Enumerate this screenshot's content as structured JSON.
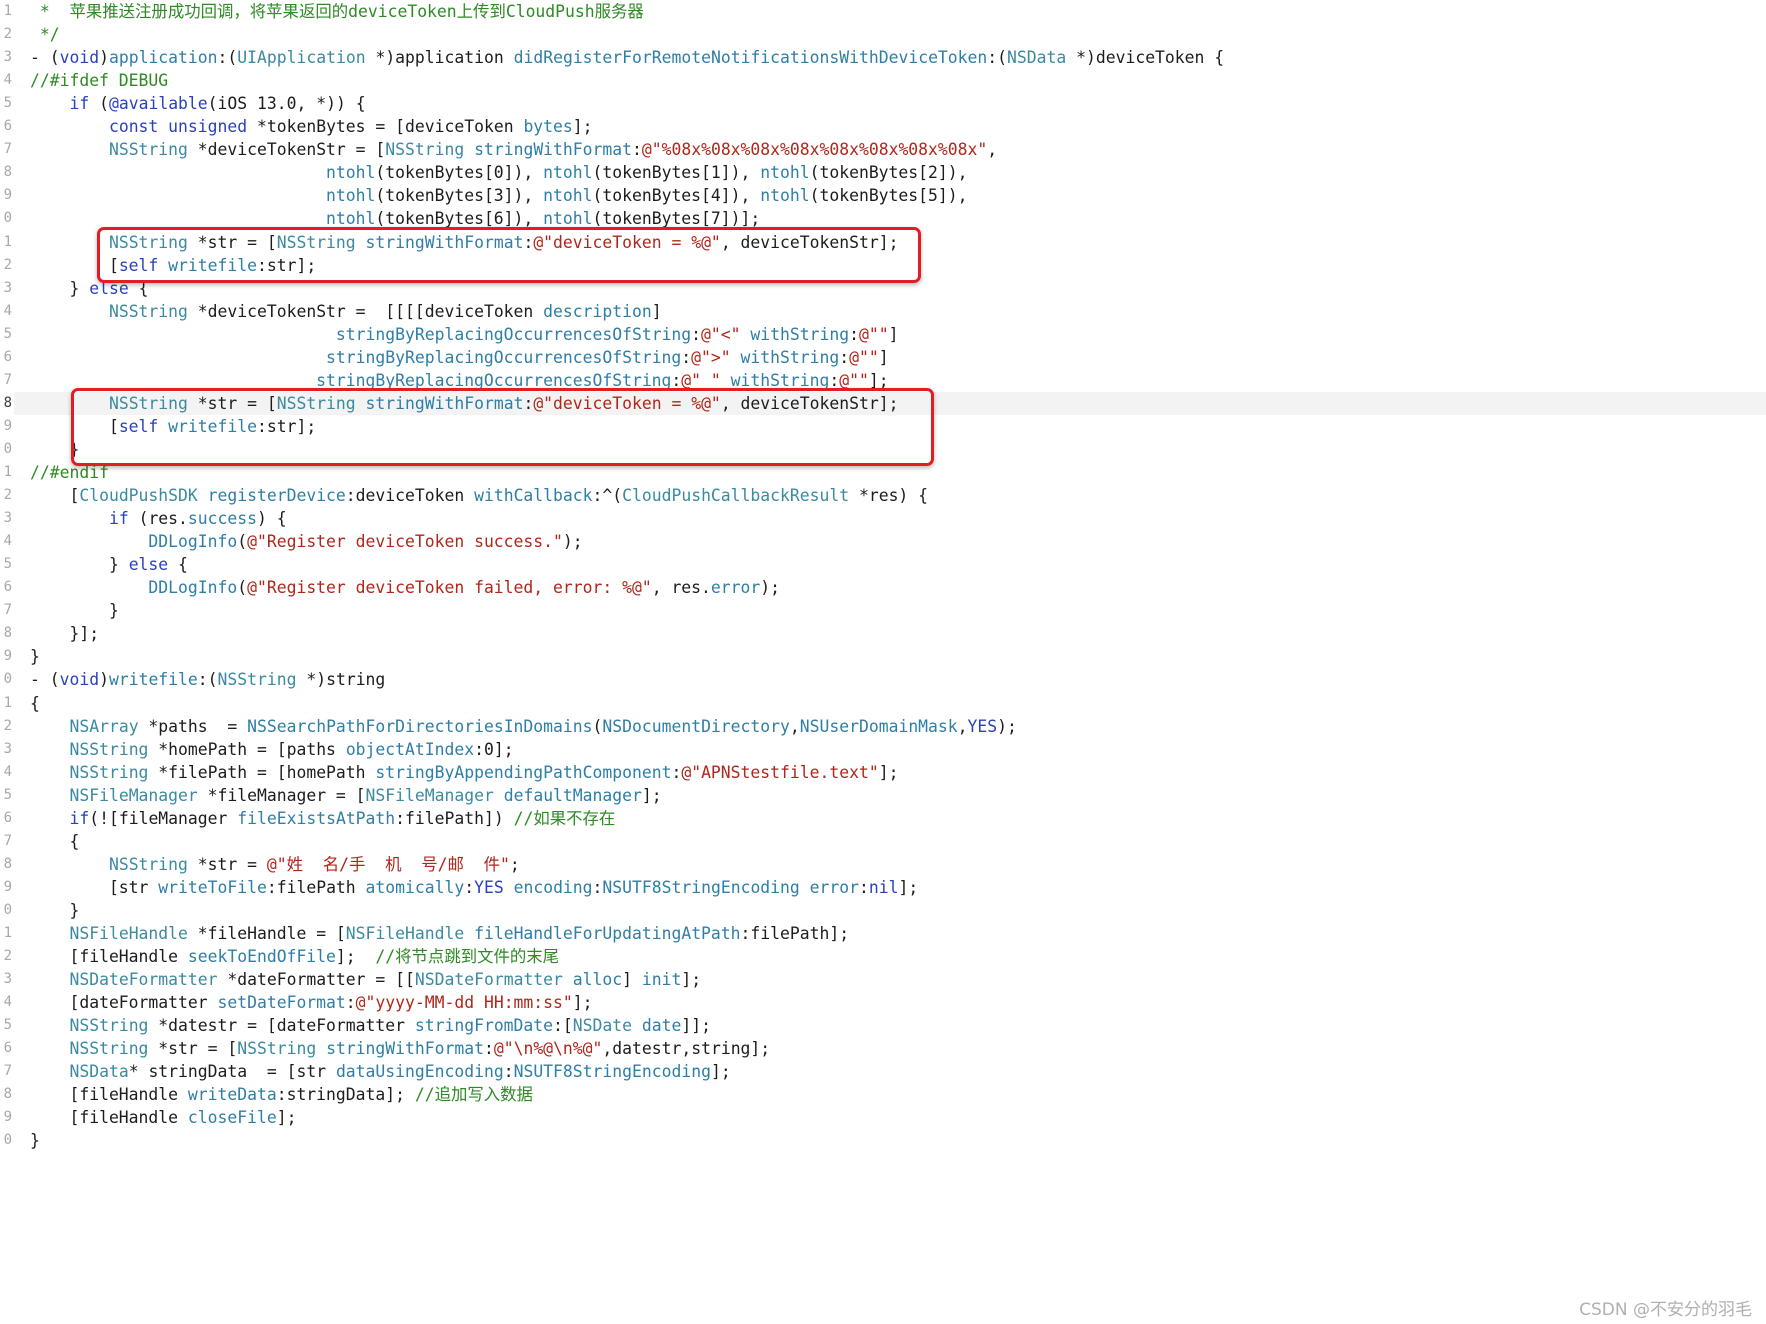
{
  "editor": {
    "line_numbers": [
      "1",
      "2",
      "3",
      "4",
      "5",
      "6",
      "7",
      "8",
      "9",
      "0",
      "1",
      "2",
      "3",
      "4",
      "5",
      "6",
      "7",
      "8",
      "9",
      "0",
      "1",
      "2",
      "3",
      "4",
      "5",
      "6",
      "7",
      "8",
      "9",
      "0",
      "1",
      "2",
      "3",
      "4",
      "5",
      "6",
      "7",
      "8",
      "9",
      "0",
      "1",
      "2",
      "3",
      "4",
      "5",
      "6",
      "7",
      "8",
      "9",
      "0"
    ],
    "current_line_index": 17,
    "highlighted_blocks": [
      [
        10,
        11
      ],
      [
        17,
        18
      ]
    ],
    "lines": [
      [
        [
          "c",
          " *  苹果推送注册成功回调，将苹果返回的deviceToken上传到CloudPush服务器"
        ]
      ],
      [
        [
          "c",
          " */"
        ]
      ],
      [
        [
          "p",
          "- ("
        ],
        [
          "k",
          "void"
        ],
        [
          "p",
          ")"
        ],
        [
          "m",
          "application"
        ],
        [
          "p",
          ":("
        ],
        [
          "ty",
          "UIApplication"
        ],
        [
          "p",
          " *)application "
        ],
        [
          "m",
          "didRegisterForRemoteNotificationsWithDeviceToken"
        ],
        [
          "p",
          ":("
        ],
        [
          "ty",
          "NSData"
        ],
        [
          "p",
          " *)deviceToken {"
        ]
      ],
      [
        [
          "c",
          "//#ifdef DEBUG"
        ]
      ],
      [
        [
          "p",
          "    "
        ],
        [
          "k",
          "if"
        ],
        [
          "p",
          " ("
        ],
        [
          "k",
          "@available"
        ],
        [
          "p",
          "(iOS 13.0, *)) {"
        ]
      ],
      [
        [
          "p",
          "        "
        ],
        [
          "k",
          "const"
        ],
        [
          "p",
          " "
        ],
        [
          "k",
          "unsigned"
        ],
        [
          "p",
          " *tokenBytes = [deviceToken "
        ],
        [
          "m",
          "bytes"
        ],
        [
          "p",
          "];"
        ]
      ],
      [
        [
          "p",
          "        "
        ],
        [
          "ty",
          "NSString"
        ],
        [
          "p",
          " *deviceTokenStr = ["
        ],
        [
          "ty",
          "NSString"
        ],
        [
          "p",
          " "
        ],
        [
          "m",
          "stringWithFormat"
        ],
        [
          "p",
          ":"
        ],
        [
          "s",
          "@\"%08x%08x%08x%08x%08x%08x%08x%08x\""
        ],
        [
          "p",
          ","
        ]
      ],
      [
        [
          "p",
          "                              "
        ],
        [
          "m",
          "ntohl"
        ],
        [
          "p",
          "(tokenBytes[0]), "
        ],
        [
          "m",
          "ntohl"
        ],
        [
          "p",
          "(tokenBytes[1]), "
        ],
        [
          "m",
          "ntohl"
        ],
        [
          "p",
          "(tokenBytes[2]),"
        ]
      ],
      [
        [
          "p",
          "                              "
        ],
        [
          "m",
          "ntohl"
        ],
        [
          "p",
          "(tokenBytes[3]), "
        ],
        [
          "m",
          "ntohl"
        ],
        [
          "p",
          "(tokenBytes[4]), "
        ],
        [
          "m",
          "ntohl"
        ],
        [
          "p",
          "(tokenBytes[5]),"
        ]
      ],
      [
        [
          "p",
          "                              "
        ],
        [
          "m",
          "ntohl"
        ],
        [
          "p",
          "(tokenBytes[6]), "
        ],
        [
          "m",
          "ntohl"
        ],
        [
          "p",
          "(tokenBytes[7])];"
        ]
      ],
      [
        [
          "p",
          "        "
        ],
        [
          "ty",
          "NSString"
        ],
        [
          "p",
          " *str = ["
        ],
        [
          "ty",
          "NSString"
        ],
        [
          "p",
          " "
        ],
        [
          "m",
          "stringWithFormat"
        ],
        [
          "p",
          ":"
        ],
        [
          "s",
          "@\"deviceToken = %@\""
        ],
        [
          "p",
          ", deviceTokenStr];"
        ]
      ],
      [
        [
          "p",
          "        ["
        ],
        [
          "k",
          "self"
        ],
        [
          "p",
          " "
        ],
        [
          "m",
          "writefile"
        ],
        [
          "p",
          ":str];"
        ]
      ],
      [
        [
          "p",
          "    } "
        ],
        [
          "k",
          "else"
        ],
        [
          "p",
          " {"
        ]
      ],
      [
        [
          "p",
          "        "
        ],
        [
          "ty",
          "NSString"
        ],
        [
          "p",
          " *deviceTokenStr =  [[[[deviceToken "
        ],
        [
          "m",
          "description"
        ],
        [
          "p",
          "]"
        ]
      ],
      [
        [
          "p",
          "                               "
        ],
        [
          "m",
          "stringByReplacingOccurrencesOfString"
        ],
        [
          "p",
          ":"
        ],
        [
          "s",
          "@\"<\""
        ],
        [
          "p",
          " "
        ],
        [
          "m",
          "withString"
        ],
        [
          "p",
          ":"
        ],
        [
          "s",
          "@\"\""
        ],
        [
          "p",
          "]"
        ]
      ],
      [
        [
          "p",
          "                              "
        ],
        [
          "m",
          "stringByReplacingOccurrencesOfString"
        ],
        [
          "p",
          ":"
        ],
        [
          "s",
          "@\">\""
        ],
        [
          "p",
          " "
        ],
        [
          "m",
          "withString"
        ],
        [
          "p",
          ":"
        ],
        [
          "s",
          "@\"\""
        ],
        [
          "p",
          "]"
        ]
      ],
      [
        [
          "p",
          "                             "
        ],
        [
          "m",
          "stringByReplacingOccurrencesOfString"
        ],
        [
          "p",
          ":"
        ],
        [
          "s",
          "@\" \""
        ],
        [
          "p",
          " "
        ],
        [
          "m",
          "withString"
        ],
        [
          "p",
          ":"
        ],
        [
          "s",
          "@\"\""
        ],
        [
          "p",
          "];"
        ]
      ],
      [
        [
          "p",
          "        "
        ],
        [
          "ty",
          "NSString"
        ],
        [
          "p",
          " *str = ["
        ],
        [
          "ty",
          "NSString"
        ],
        [
          "p",
          " "
        ],
        [
          "m",
          "stringWithFormat"
        ],
        [
          "p",
          ":"
        ],
        [
          "s",
          "@\"deviceToken = %@\""
        ],
        [
          "p",
          ", deviceTokenStr];"
        ]
      ],
      [
        [
          "p",
          "        ["
        ],
        [
          "k",
          "self"
        ],
        [
          "p",
          " "
        ],
        [
          "m",
          "writefile"
        ],
        [
          "p",
          ":str];"
        ]
      ],
      [
        [
          "p",
          "    }"
        ]
      ],
      [
        [
          "c",
          "//#endif"
        ]
      ],
      [
        [
          "p",
          "    ["
        ],
        [
          "ty",
          "CloudPushSDK"
        ],
        [
          "p",
          " "
        ],
        [
          "m",
          "registerDevice"
        ],
        [
          "p",
          ":deviceToken "
        ],
        [
          "m",
          "withCallback"
        ],
        [
          "p",
          ":^("
        ],
        [
          "ty",
          "CloudPushCallbackResult"
        ],
        [
          "p",
          " *res) {"
        ]
      ],
      [
        [
          "p",
          "        "
        ],
        [
          "k",
          "if"
        ],
        [
          "p",
          " (res."
        ],
        [
          "m",
          "success"
        ],
        [
          "p",
          ") {"
        ]
      ],
      [
        [
          "p",
          "            "
        ],
        [
          "m",
          "DDLogInfo"
        ],
        [
          "p",
          "("
        ],
        [
          "s",
          "@\"Register deviceToken success.\""
        ],
        [
          "p",
          ");"
        ]
      ],
      [
        [
          "p",
          "        } "
        ],
        [
          "k",
          "else"
        ],
        [
          "p",
          " {"
        ]
      ],
      [
        [
          "p",
          "            "
        ],
        [
          "m",
          "DDLogInfo"
        ],
        [
          "p",
          "("
        ],
        [
          "s",
          "@\"Register deviceToken failed, error: %@\""
        ],
        [
          "p",
          ", res."
        ],
        [
          "m",
          "error"
        ],
        [
          "p",
          ");"
        ]
      ],
      [
        [
          "p",
          "        }"
        ]
      ],
      [
        [
          "p",
          "    }];"
        ]
      ],
      [
        [
          "p",
          "}"
        ]
      ],
      [
        [
          "p",
          "- ("
        ],
        [
          "k",
          "void"
        ],
        [
          "p",
          ")"
        ],
        [
          "m",
          "writefile"
        ],
        [
          "p",
          ":("
        ],
        [
          "ty",
          "NSString"
        ],
        [
          "p",
          " *)string"
        ]
      ],
      [
        [
          "p",
          "{"
        ]
      ],
      [
        [
          "p",
          "    "
        ],
        [
          "ty",
          "NSArray"
        ],
        [
          "p",
          " *paths  = "
        ],
        [
          "m",
          "NSSearchPathForDirectoriesInDomains"
        ],
        [
          "p",
          "("
        ],
        [
          "m",
          "NSDocumentDirectory"
        ],
        [
          "p",
          ","
        ],
        [
          "m",
          "NSUserDomainMask"
        ],
        [
          "p",
          ","
        ],
        [
          "k",
          "YES"
        ],
        [
          "p",
          ");"
        ]
      ],
      [
        [
          "p",
          "    "
        ],
        [
          "ty",
          "NSString"
        ],
        [
          "p",
          " *homePath = [paths "
        ],
        [
          "m",
          "objectAtIndex"
        ],
        [
          "p",
          ":0];"
        ]
      ],
      [
        [
          "p",
          "    "
        ],
        [
          "ty",
          "NSString"
        ],
        [
          "p",
          " *filePath = [homePath "
        ],
        [
          "m",
          "stringByAppendingPathComponent"
        ],
        [
          "p",
          ":"
        ],
        [
          "s",
          "@\"APNStestfile.text\""
        ],
        [
          "p",
          "];"
        ]
      ],
      [
        [
          "p",
          "    "
        ],
        [
          "ty",
          "NSFileManager"
        ],
        [
          "p",
          " *fileManager = ["
        ],
        [
          "ty",
          "NSFileManager"
        ],
        [
          "p",
          " "
        ],
        [
          "m",
          "defaultManager"
        ],
        [
          "p",
          "];"
        ]
      ],
      [
        [
          "p",
          "    "
        ],
        [
          "k",
          "if"
        ],
        [
          "p",
          "(![fileManager "
        ],
        [
          "m",
          "fileExistsAtPath"
        ],
        [
          "p",
          ":filePath]) "
        ],
        [
          "c",
          "//如果不存在"
        ]
      ],
      [
        [
          "p",
          "    {"
        ]
      ],
      [
        [
          "p",
          "        "
        ],
        [
          "ty",
          "NSString"
        ],
        [
          "p",
          " *str = "
        ],
        [
          "s",
          "@\"姓  名/手  机  号/邮  件\""
        ],
        [
          "p",
          ";"
        ]
      ],
      [
        [
          "p",
          "        [str "
        ],
        [
          "m",
          "writeToFile"
        ],
        [
          "p",
          ":filePath "
        ],
        [
          "m",
          "atomically"
        ],
        [
          "p",
          ":"
        ],
        [
          "k",
          "YES"
        ],
        [
          "p",
          " "
        ],
        [
          "m",
          "encoding"
        ],
        [
          "p",
          ":"
        ],
        [
          "m",
          "NSUTF8StringEncoding"
        ],
        [
          "p",
          " "
        ],
        [
          "m",
          "error"
        ],
        [
          "p",
          ":"
        ],
        [
          "k",
          "nil"
        ],
        [
          "p",
          "];"
        ]
      ],
      [
        [
          "p",
          "    }"
        ]
      ],
      [
        [
          "p",
          "    "
        ],
        [
          "ty",
          "NSFileHandle"
        ],
        [
          "p",
          " *fileHandle = ["
        ],
        [
          "ty",
          "NSFileHandle"
        ],
        [
          "p",
          " "
        ],
        [
          "m",
          "fileHandleForUpdatingAtPath"
        ],
        [
          "p",
          ":filePath];"
        ]
      ],
      [
        [
          "p",
          "    [fileHandle "
        ],
        [
          "m",
          "seekToEndOfFile"
        ],
        [
          "p",
          "];  "
        ],
        [
          "c",
          "//将节点跳到文件的末尾"
        ]
      ],
      [
        [
          "p",
          "    "
        ],
        [
          "ty",
          "NSDateFormatter"
        ],
        [
          "p",
          " *dateFormatter = [["
        ],
        [
          "ty",
          "NSDateFormatter"
        ],
        [
          "p",
          " "
        ],
        [
          "m",
          "alloc"
        ],
        [
          "p",
          "] "
        ],
        [
          "m",
          "init"
        ],
        [
          "p",
          "];"
        ]
      ],
      [
        [
          "p",
          "    [dateFormatter "
        ],
        [
          "m",
          "setDateFormat"
        ],
        [
          "p",
          ":"
        ],
        [
          "s",
          "@\"yyyy-MM-dd HH:mm:ss\""
        ],
        [
          "p",
          "];"
        ]
      ],
      [
        [
          "p",
          "    "
        ],
        [
          "ty",
          "NSString"
        ],
        [
          "p",
          " *datestr = [dateFormatter "
        ],
        [
          "m",
          "stringFromDate"
        ],
        [
          "p",
          ":["
        ],
        [
          "ty",
          "NSDate"
        ],
        [
          "p",
          " "
        ],
        [
          "m",
          "date"
        ],
        [
          "p",
          "]];"
        ]
      ],
      [
        [
          "p",
          "    "
        ],
        [
          "ty",
          "NSString"
        ],
        [
          "p",
          " *str = ["
        ],
        [
          "ty",
          "NSString"
        ],
        [
          "p",
          " "
        ],
        [
          "m",
          "stringWithFormat"
        ],
        [
          "p",
          ":"
        ],
        [
          "s",
          "@\"\\n%@\\n%@\""
        ],
        [
          "p",
          ",datestr,string];"
        ]
      ],
      [
        [
          "p",
          "    "
        ],
        [
          "ty",
          "NSData"
        ],
        [
          "p",
          "* stringData  = [str "
        ],
        [
          "m",
          "dataUsingEncoding"
        ],
        [
          "p",
          ":"
        ],
        [
          "m",
          "NSUTF8StringEncoding"
        ],
        [
          "p",
          "];"
        ]
      ],
      [
        [
          "p",
          "    [fileHandle "
        ],
        [
          "m",
          "writeData"
        ],
        [
          "p",
          ":stringData]; "
        ],
        [
          "c",
          "//追加写入数据"
        ]
      ],
      [
        [
          "p",
          "    [fileHandle "
        ],
        [
          "m",
          "closeFile"
        ],
        [
          "p",
          "];"
        ]
      ],
      [
        [
          "p",
          "}"
        ]
      ]
    ]
  },
  "colors": {
    "plain": "#1c1c1c",
    "keyword": "#2a40bf",
    "type": "#3b8aa0",
    "method": "#2f7ea6",
    "string": "#b1261b",
    "comment": "#2e8a24",
    "annotation_box": "#e21e24",
    "current_line_bg": "#f3f3f3"
  },
  "watermark": "CSDN @不安分的羽毛"
}
